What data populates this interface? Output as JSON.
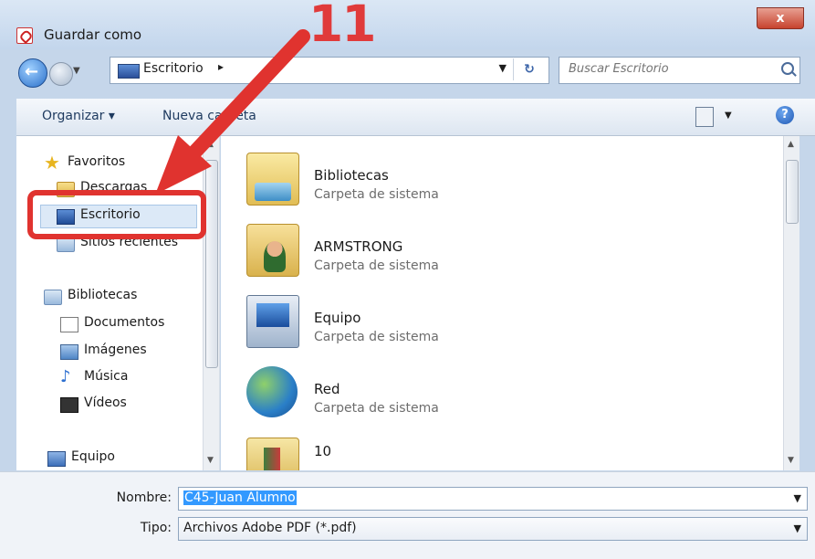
{
  "window": {
    "title": "Guardar como",
    "close_label": "x"
  },
  "annotation": {
    "step": "11"
  },
  "address": {
    "location": "Escritorio",
    "separator": "▸",
    "search_placeholder": "Buscar Escritorio"
  },
  "toolbar": {
    "organize": "Organizar ▾",
    "new_folder": "Nueva carpeta"
  },
  "nav": {
    "favorites": "Favoritos",
    "downloads": "Descargas",
    "desktop": "Escritorio",
    "recent": "Sitios recientes",
    "libraries": "Bibliotecas",
    "documents": "Documentos",
    "images": "Imágenes",
    "music": "Música",
    "videos": "Vídeos",
    "computer": "Equipo"
  },
  "files": [
    {
      "name": "Bibliotecas",
      "type": "Carpeta de sistema"
    },
    {
      "name": "ARMSTRONG",
      "type": "Carpeta de sistema"
    },
    {
      "name": "Equipo",
      "type": "Carpeta de sistema"
    },
    {
      "name": "Red",
      "type": "Carpeta de sistema"
    },
    {
      "name": "10",
      "type": ""
    }
  ],
  "form": {
    "name_label": "Nombre:",
    "name_value": "C45-Juan Alumno",
    "type_label": "Tipo:",
    "type_value": "Archivos Adobe PDF (*.pdf)"
  }
}
